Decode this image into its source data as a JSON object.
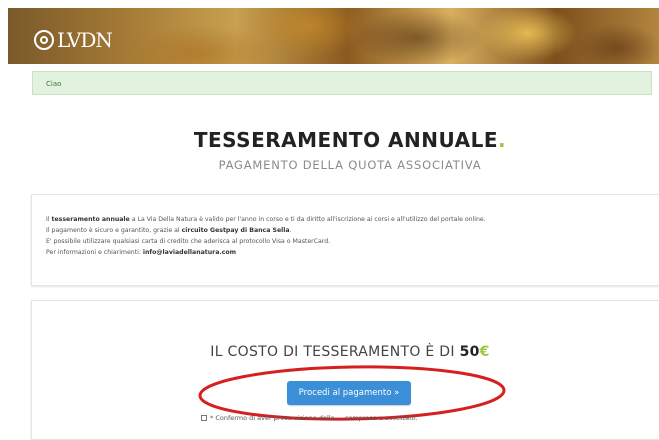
{
  "header": {
    "logo_text": "LVDN"
  },
  "alert": {
    "text": "Ciao"
  },
  "page": {
    "title": "TESSERAMENTO ANNUALE",
    "title_dot": ".",
    "subtitle": "PAGAMENTO DELLA QUOTA ASSOCIATIVA"
  },
  "info": {
    "line1_pre": "Il ",
    "line1_bold1": "tesseramento annuale",
    "line1_post": " a La Via Della Natura è valido per l'anno in corso e ti da diritto all'iscrizione ai corsi e all'utilizzo del portale online.",
    "line2_pre": "Il pagamento è sicuro e garantito, grazie al ",
    "line2_bold": "circuito Gestpay di Banca Sella",
    "line2_post": ".",
    "line3": "E' possibile utilizzare qualsiasi carta di credito che aderisca al protocollo Visa o MasterCard.",
    "line4_pre": "Per informazioni e chiarimenti: ",
    "line4_email": "info@laviadellanatura.com"
  },
  "payment": {
    "cost_label": "IL COSTO DI TESSERAMENTO È DI ",
    "amount": "50",
    "currency": "€",
    "button_label": "Procedi al pagamento »",
    "confirm_text": "* Confermo di aver preso visione della ... compreso e accettato."
  },
  "colors": {
    "accent_green": "#9dc73f",
    "button_blue": "#3a8fd8",
    "annotation_red": "#d62020"
  }
}
